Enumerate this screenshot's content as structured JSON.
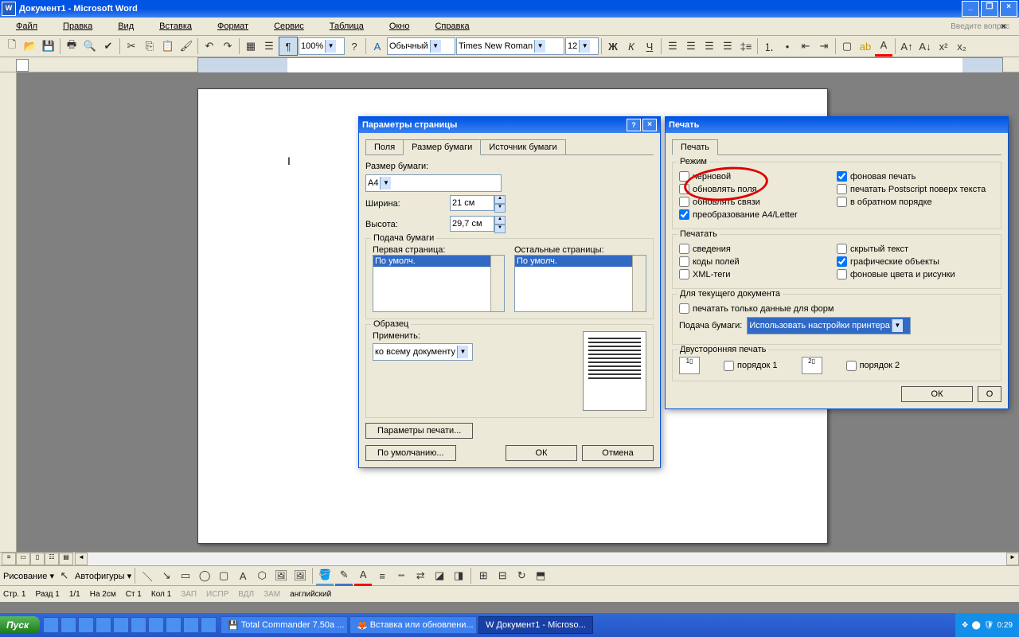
{
  "title": "Документ1 - Microsoft Word",
  "menu": [
    "Файл",
    "Правка",
    "Вид",
    "Вставка",
    "Формат",
    "Сервис",
    "Таблица",
    "Окно",
    "Справка"
  ],
  "askq": "Введите вопрос",
  "zoom": "100%",
  "style": "Обычный",
  "font": "Times New Roman",
  "size": "12",
  "dlg1": {
    "title": "Параметры страницы",
    "tabs": [
      "Поля",
      "Размер бумаги",
      "Источник бумаги"
    ],
    "paperLabel": "Размер бумаги:",
    "paper": "A4",
    "widthLabel": "Ширина:",
    "width": "21 см",
    "heightLabel": "Высота:",
    "height": "29,7 см",
    "feedGroup": "Подача бумаги",
    "first": "Первая страница:",
    "other": "Остальные страницы:",
    "def": "По умолч.",
    "sampleGroup": "Образец",
    "applyLabel": "Применить:",
    "apply": "ко всему документу",
    "printParams": "Параметры печати...",
    "defaultBtn": "По умолчанию...",
    "ok": "ОК",
    "cancel": "Отмена"
  },
  "dlg2": {
    "title": "Печать",
    "tab": "Печать",
    "modeGroup": "Режим",
    "chk": {
      "draft": "черновой",
      "updateFields": "обновлять поля",
      "updateLinks": "обновлять связи",
      "a4letter": "преобразование A4/Letter",
      "bgprint": "фоновая печать",
      "postscript": "печатать Postscript поверх текста",
      "reverse": "в обратном порядке"
    },
    "printGroup2": "Печатать",
    "chk2": {
      "info": "сведения",
      "fieldCodes": "коды полей",
      "xml": "XML-теги",
      "hidden": "скрытый текст",
      "drawings": "графические объекты",
      "bgcolors": "фоновые цвета и рисунки"
    },
    "curDocGroup": "Для текущего документа",
    "formsOnly": "печатать только данные для форм",
    "feedLabel": "Подача бумаги:",
    "feed": "Использовать настройки принтера",
    "duplexGroup": "Двусторонняя печать",
    "order1": "порядок 1",
    "order2": "порядок 2",
    "ok": "ОК"
  },
  "status": {
    "page": "Стр. 1",
    "sec": "Разд 1",
    "pages": "1/1",
    "at": "На 2см",
    "ln": "Ст 1",
    "col": "Кол 1",
    "rec": "ЗАП",
    "rev": "ИСПР",
    "ext": "ВДЛ",
    "ovr": "ЗАМ",
    "lang": "английский"
  },
  "draw": {
    "label": "Рисование",
    "autoshapes": "Автофигуры"
  },
  "taskbar": {
    "start": "Пуск",
    "tasks": [
      "Total Commander 7.50a ...",
      "Вставка или обновлени...",
      "Документ1 - Microso..."
    ],
    "time": "0:29"
  }
}
